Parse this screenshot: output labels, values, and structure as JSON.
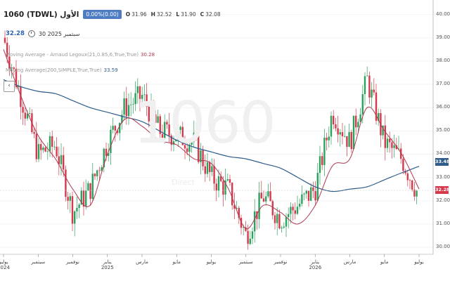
{
  "header": {
    "symbol": "1060 (TDWL) الأول",
    "change_badge": "0.00%(0.00)",
    "ohlc": [
      {
        "k": "O",
        "v": "31.96"
      },
      {
        "k": "H",
        "v": "32.52"
      },
      {
        "k": "L",
        "v": "31.90"
      },
      {
        "k": "C",
        "v": "32.08"
      }
    ],
    "last_price": "32.28",
    "date_text": "30 سبتمبر 2025"
  },
  "studies": [
    {
      "label": "Moving Average - Arnaud Legoux(21,0.85,6,True,True)",
      "value": "30.28",
      "color": "#b0384f"
    },
    {
      "label": "Moving Average(200,SIMPLE,True,True)",
      "value": "33.59",
      "color": "#2f5c8a"
    }
  ],
  "watermark": {
    "text": "1060",
    "sub": "Direct"
  },
  "colors": {
    "up": "#2ca25f",
    "down": "#d6384c",
    "alma": "#b0384f",
    "sma": "#2f5c8a",
    "last_tag": "#d6384c",
    "sma_tag": "#2f5c8a"
  },
  "price_tags": {
    "sma": "33.48",
    "last": "32.28"
  },
  "chart_data": {
    "type": "line",
    "ylim": [
      29.7,
      40.2
    ],
    "y_ticks": [
      "30.00",
      "31.00",
      "32.00",
      "33.00",
      "34.00",
      "35.00",
      "36.00",
      "37.00",
      "38.00",
      "39.00",
      "40.00"
    ],
    "x_labels": [
      {
        "t": "يوليو",
        "y": "2024"
      },
      {
        "t": "سبتمبر",
        "y": ""
      },
      {
        "t": "نوفمبر",
        "y": ""
      },
      {
        "t": "يناير",
        "y": "2025"
      },
      {
        "t": "مارس",
        "y": ""
      },
      {
        "t": "مايو",
        "y": ""
      },
      {
        "t": "يوليو",
        "y": ""
      },
      {
        "t": "سبتمبر",
        "y": ""
      },
      {
        "t": "نوفمبر",
        "y": ""
      },
      {
        "t": "يناير",
        "y": "2026"
      },
      {
        "t": "مارس",
        "y": ""
      },
      {
        "t": "مايو",
        "y": ""
      },
      {
        "t": "يوليو",
        "y": ""
      }
    ],
    "x": [
      "Jul 2024",
      "Aug 2024",
      "Sep 2024",
      "Oct 2024",
      "Nov 2024",
      "Dec 2024",
      "Jan 2025",
      "Feb 2025",
      "Mar 2025",
      "Apr 2025",
      "May 2025",
      "Jun 2025",
      "Jul 2025",
      "Aug 2025",
      "Sep 2025",
      "Oct 2025",
      "Nov 2025",
      "Dec 2025",
      "Jan 2026",
      "Feb 2026",
      "Mar 2026",
      "Apr 2026",
      "May 2026",
      "Jun 2026",
      "Jul 2026"
    ],
    "series": [
      {
        "name": "",
        "values": [
          39.0,
          36.5,
          34.0,
          34.4,
          31.5,
          32.5,
          34.5,
          36.0,
          36.5,
          35.0,
          34.8,
          34.5,
          33.0,
          32.5,
          30.5,
          32.2,
          31.2,
          31.8,
          32.5,
          35.8,
          34.5,
          37.2,
          34.5,
          33.8,
          32.2
        ]
      },
      {
        "name": "Moving Average - Arnaud Legoux(21,0.85,6,True,True)",
        "values": [
          38.5,
          36.5,
          34.8,
          33.8,
          32.5,
          31.8,
          34.0,
          35.5,
          35.2,
          34.6,
          34.4,
          33.8,
          33.6,
          32.5,
          30.8,
          31.8,
          31.5,
          31.0,
          31.8,
          33.5,
          33.8,
          36.0,
          35.0,
          34.0,
          32.5
        ]
      },
      {
        "name": "Moving Average(200,SIMPLE,True,True)",
        "values": [
          37.2,
          36.9,
          36.7,
          36.6,
          36.3,
          36.0,
          35.8,
          35.6,
          35.4,
          35.0,
          34.6,
          34.3,
          34.1,
          33.9,
          33.8,
          33.6,
          33.4,
          33.0,
          32.6,
          32.4,
          32.5,
          32.6,
          32.9,
          33.2,
          33.48
        ]
      }
    ]
  }
}
